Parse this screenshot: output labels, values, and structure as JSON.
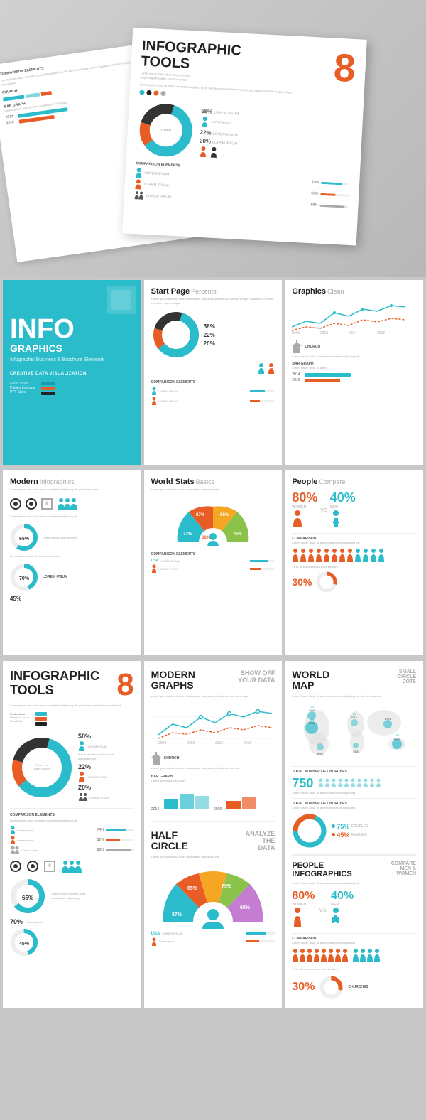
{
  "hero": {
    "title": "INFOGRAPHIC\nTOOLS",
    "number": "8",
    "donut_segments": [
      56,
      22,
      22
    ],
    "lorem_ipsum": "Lorem Ipsum Dolor",
    "bar_graph_label": "BAR GRAPH",
    "year1": "2014",
    "year2": "2016",
    "fonts_used": "Fonts Used:\nHelvetica Nova\nNew Bold",
    "pct1": "58%",
    "pct2": "22%",
    "pct3": "20%"
  },
  "row1": {
    "cell1": {
      "big_title": "INFO",
      "big_title2": "GRAPHICS",
      "tagline": "Infographic Business &\nBrochure Elements",
      "cta": "CREATIVE DATA VISUALIZATION",
      "fonts": "Fonts Used:",
      "font1": "Palatin Linotype",
      "font2": "PTT Slans"
    },
    "cell2": {
      "title": "Start Page",
      "accent": "Percents",
      "pct1": "58%",
      "pct2": "22%",
      "pct3": "20%",
      "lorem1": "LOREM IPSUM",
      "lorem2": "LOREM IPSUM",
      "body_text": "Lorem ipsum dolor sit amet consectetur adipiscing elit sed do eiusmod tempor incididunt ut labore et dolore magna aliqua"
    },
    "cell3": {
      "title": "Graphics",
      "accent": "Clean",
      "church_label": "CHURCH",
      "bar_graph_label": "BAR GRAPH",
      "year1": "2014",
      "year2": "2016",
      "body_text": "Lorem ipsum dolor sit amet consectetur adipiscing elit"
    }
  },
  "row2": {
    "cell1": {
      "title": "Modern",
      "accent": "Infographics",
      "pct1": "65%",
      "pct2": "70%",
      "pct3": "45%",
      "lorem": "LOREM IPSUM",
      "body_text": "Lorem ipsum dolor sit amet consectetur adipiscing elit sed do eiusmod"
    },
    "cell2": {
      "title": "World Stats",
      "accent": "Basics",
      "pct1": "77%",
      "pct2": "66%",
      "pct3": "87%",
      "pct4": "68%",
      "pct5": "75%",
      "usa_label": "USA",
      "lorem1": "LOREM IPSUM",
      "lorem2": "LOREM IPSUM",
      "body_text": "Lorem ipsum dolor sit amet consectetur adipiscing elit"
    },
    "cell3": {
      "title": "People",
      "accent": "Compare",
      "women_pct": "80%",
      "men_pct": "40%",
      "women_label": "WOMEN",
      "men_label": "MEN",
      "vs": "VS",
      "comparison_label": "COMPARISON",
      "churches_label": "18 of 30 churches has more families",
      "church_pct": "30%",
      "body_text": "Lorem ipsum dolor sit amet consectetur adipiscing elit"
    }
  },
  "bottom_left": {
    "title1": "INFOGRAPHIC",
    "title2": "TOOLS",
    "number": "8",
    "fonts_label": "Fonts Used:",
    "font1": "Helvetica Nova",
    "font2": "New Bold",
    "pct1": "58%",
    "pct2": "22%",
    "pct3": "20%",
    "lorem1": "LOREM IPSUM",
    "lorem2": "LOREM IPSUM",
    "lorem3": "LOREM IPSUM",
    "comparison_label": "COMPARISON ELEMENTS",
    "body_text": "Lorem ipsum dolor sit amet consectetur adipiscing elit sed do eiusmod tempor incididunt",
    "pct_65": "65%",
    "pct_70": "70%",
    "pct_45": "45%"
  },
  "bottom_mid": {
    "title1": "MODERN",
    "title2": "GRAPHS",
    "accent1": "SHOW OFF",
    "accent2": "YOUR DATA",
    "church_label": "CHURCH",
    "bar_graph_label": "BAR GRAPH",
    "year1": "2014",
    "year2": "2016",
    "half_circle_title1": "HALF",
    "half_circle_title2": "CIRCLE",
    "half_accent1": "ANALYZE",
    "half_accent2": "THE",
    "half_accent3": "DATA",
    "pct1": "87%",
    "pct2": "65%",
    "pct3": "75%",
    "usa_label": "USA",
    "lorem": "LOREM IPSUM",
    "body_text": "Lorem ipsum dolor sit amet consectetur adipiscing elit"
  },
  "bottom_right": {
    "world_map_title1": "WORLD",
    "world_map_title2": "MAP",
    "world_accent1": "SMALL",
    "world_accent2": "CIRCLE",
    "world_accent3": "DOTS",
    "can_label": "CAN",
    "can_val": "150",
    "fra_label": "FRA",
    "fra_val": "50",
    "usa_label": "USA",
    "usa_val": "150",
    "bra_label": "BRA",
    "bra_val": "",
    "sfa_label": "SFA",
    "sfa_val": "",
    "chn_label": "CHN",
    "chn_val": "",
    "aus_label": "AUS",
    "aus_val": "150",
    "churches_total": "750",
    "churches_label": "TOTAL NUMBER OF CHURCHES",
    "total_churches2": "TOTAL NUMBER OF CHURCHES",
    "couples_pct": "75%",
    "families_pct": "45%",
    "couples_label": "COUPLES",
    "families_label": "FAMILIES",
    "people_title1": "PEOPLE",
    "people_title2": "INFOGRAPHICS",
    "people_accent1": "COMPARE",
    "people_accent2": "MEN &",
    "people_accent3": "WOMEN",
    "women_pct": "80%",
    "men_pct": "40%",
    "women_label": "WOMEN",
    "men_label": "MEN",
    "vs": "VS",
    "comparison_label": "COMPARISON",
    "churches_more": "18 of 30 churches has more families",
    "church_pct2": "30%",
    "churches_label2": "CHURCHES"
  }
}
